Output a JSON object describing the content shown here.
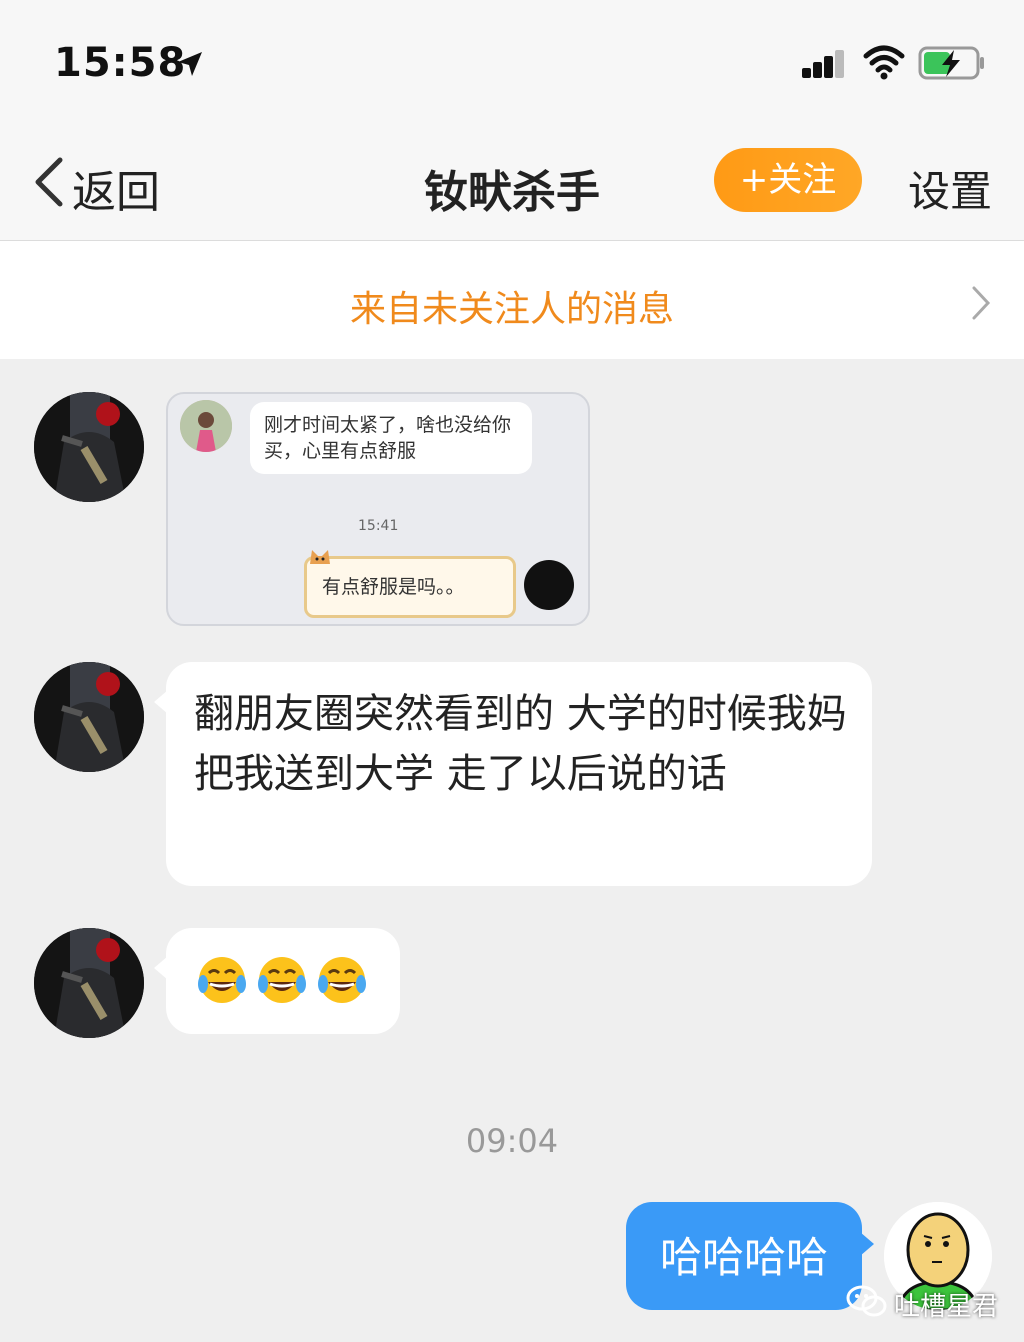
{
  "status_bar": {
    "time": "15:58"
  },
  "nav": {
    "back_label": "返回",
    "title": "钕畎杀手",
    "follow_label": "+关注",
    "settings_label": "设置"
  },
  "notice": {
    "label": "来自未关注人的消息"
  },
  "messages": [
    {
      "type": "screenshot",
      "inner": {
        "text1": "刚才时间太紧了，啥也没给你买，心里有点舒服",
        "time": "15:41",
        "text2": "有点舒服是吗。。"
      }
    },
    {
      "type": "text",
      "text": "翻朋友圈突然看到的  大学的时候我妈把我送到大学 走了以后说的话"
    },
    {
      "type": "emoji",
      "emojis": [
        "face-with-tears-of-joy",
        "face-with-tears-of-joy",
        "face-with-tears-of-joy"
      ]
    }
  ],
  "timestamp": "09:04",
  "my_message": {
    "text": "哈哈哈哈"
  },
  "watermark": {
    "label": "吐槽星君"
  },
  "colors": {
    "accent_orange": "#f08a1c",
    "follow_button": "#ffa21a",
    "my_bubble": "#3a9af7",
    "background": "#efefef"
  }
}
